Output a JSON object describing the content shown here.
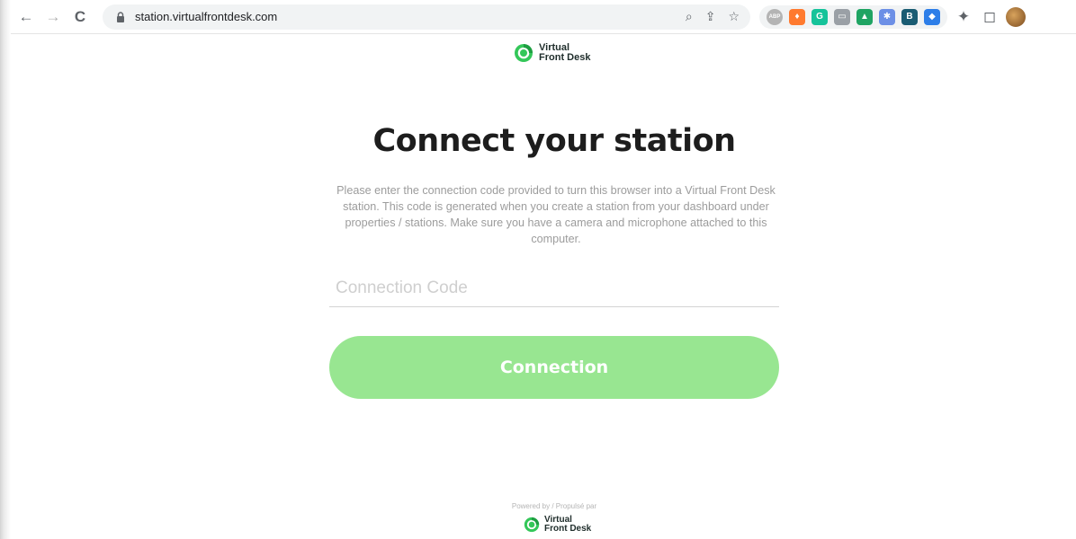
{
  "browser": {
    "url": "station.virtualfrontdesk.com",
    "back_icon": "←",
    "forward_icon": "→",
    "reload_icon": "C",
    "zoom_icon": "⌕",
    "share_icon": "⇪",
    "star_icon": "☆",
    "extensions": [
      {
        "name": "abp",
        "label": "ABP",
        "color": "#b4b4b4"
      },
      {
        "name": "hubspot",
        "label": "♦",
        "color": "#ff7a2f"
      },
      {
        "name": "grammarly",
        "label": "G",
        "color": "#15c39a"
      },
      {
        "name": "screenshot",
        "label": "▭",
        "color": "#9aa0a6"
      },
      {
        "name": "drive",
        "label": "▲",
        "color": "#1fa463"
      },
      {
        "name": "snowflake",
        "label": "✱",
        "color": "#6c8fe6"
      },
      {
        "name": "bookmark",
        "label": "B",
        "color": "#1a5c73"
      },
      {
        "name": "tag",
        "label": "◆",
        "color": "#2d7ee8"
      }
    ],
    "puzzle_icon": "✦",
    "sidepanel_icon": "◻"
  },
  "logo": {
    "line1": "Virtual",
    "line2": "Front Desk"
  },
  "main": {
    "title": "Connect your station",
    "description": "Please enter the connection code provided to turn this browser into a Virtual Front Desk station. This code is generated when you create a station from your dashboard under properties / stations. Make sure you have a camera and microphone attached to this computer.",
    "code_placeholder": "Connection Code",
    "code_value": "",
    "connect_label": "Connection"
  },
  "footer": {
    "powered_by": "Powered by / Propulsé par"
  },
  "colors": {
    "accent": "#98e691",
    "logo_green": "#34c759"
  }
}
